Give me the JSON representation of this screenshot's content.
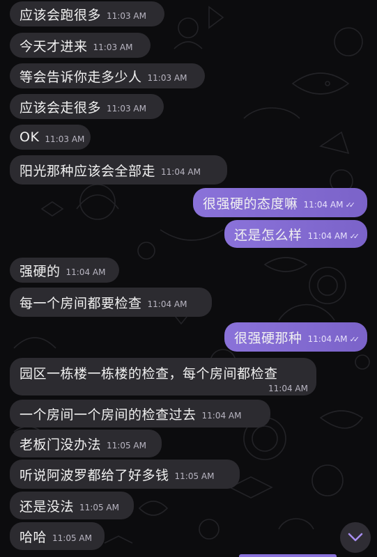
{
  "messages": [
    {
      "dir": "in",
      "text": "应该会跑很多",
      "time": "11:03 AM"
    },
    {
      "dir": "in",
      "text": "今天才进来",
      "time": "11:03 AM"
    },
    {
      "dir": "in",
      "text": "等会告诉你走多少人",
      "time": "11:03 AM"
    },
    {
      "dir": "in",
      "text": "应该会走很多",
      "time": "11:03 AM"
    },
    {
      "dir": "in",
      "text": "OK",
      "time": "11:03 AM"
    },
    {
      "dir": "in",
      "text": "阳光那种应该会全部走",
      "time": "11:04 AM"
    },
    {
      "dir": "out",
      "text": "很强硬的态度嘛",
      "time": "11:04 AM",
      "status": "read"
    },
    {
      "dir": "out",
      "text": "还是怎么样",
      "time": "11:04 AM",
      "status": "read"
    },
    {
      "dir": "in",
      "text": "强硬的",
      "time": "11:04 AM"
    },
    {
      "dir": "in",
      "text": "每一个房间都要检查",
      "time": "11:04 AM"
    },
    {
      "dir": "out",
      "text": "很强硬那种",
      "time": "11:04 AM",
      "status": "read"
    },
    {
      "dir": "in",
      "text": "园区一栋楼一栋楼的检查，每个房间都检查",
      "time": "11:04 AM"
    },
    {
      "dir": "in",
      "text": "一个房间一个房间的检查过去",
      "time": "11:04 AM"
    },
    {
      "dir": "in",
      "text": "老板门没办法",
      "time": "11:05 AM"
    },
    {
      "dir": "in",
      "text": "听说阿波罗都给了好多钱",
      "time": "11:05 AM"
    },
    {
      "dir": "in",
      "text": "还是没法",
      "time": "11:05 AM"
    },
    {
      "dir": "in",
      "text": "哈哈",
      "time": "11:05 AM"
    }
  ],
  "colors": {
    "incoming": "#2c2b30",
    "outgoing": "#8a72d9",
    "background": "#0c0c0e"
  },
  "icons": {
    "read_status": "double-check-icon",
    "scroll_down": "chevron-down-icon"
  }
}
